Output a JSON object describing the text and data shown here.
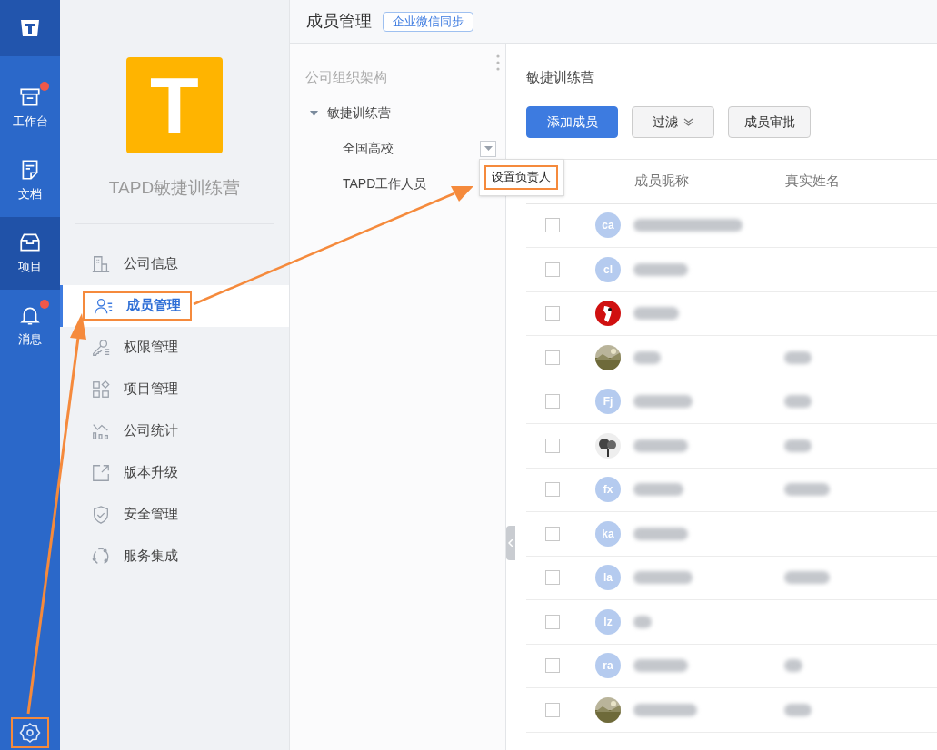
{
  "rail": {
    "items": [
      {
        "kind": "inbox",
        "label": "工作台",
        "selected": false,
        "badge": true
      },
      {
        "kind": "doc",
        "label": "文档",
        "selected": false,
        "badge": false
      },
      {
        "kind": "project",
        "label": "项目",
        "selected": true,
        "badge": false
      },
      {
        "kind": "bell",
        "label": "消息",
        "selected": false,
        "badge": true
      }
    ],
    "settings": {
      "highlighted": true
    }
  },
  "company": {
    "logo_letter": "T",
    "name": "TAPD敏捷训练营"
  },
  "nav": [
    {
      "kind": "building",
      "label": "公司信息",
      "selected": false,
      "highlighted": false
    },
    {
      "kind": "user",
      "label": "成员管理",
      "selected": true,
      "highlighted": true
    },
    {
      "kind": "key",
      "label": "权限管理",
      "selected": false,
      "highlighted": false
    },
    {
      "kind": "grid",
      "label": "项目管理",
      "selected": false,
      "highlighted": false
    },
    {
      "kind": "stats",
      "label": "公司统计",
      "selected": false,
      "highlighted": false
    },
    {
      "kind": "upgrade",
      "label": "版本升级",
      "selected": false,
      "highlighted": false
    },
    {
      "kind": "shield",
      "label": "安全管理",
      "selected": false,
      "highlighted": false
    },
    {
      "kind": "cycle",
      "label": "服务集成",
      "selected": false,
      "highlighted": false
    }
  ],
  "header": {
    "title": "成员管理",
    "sync_button": "企业微信同步"
  },
  "org_tree": {
    "heading": "公司组织架构",
    "root": {
      "label": "敏捷训练营",
      "expanded": true,
      "children": [
        {
          "label": "全国高校",
          "menu_open": true
        },
        {
          "label": "TAPD工作人员",
          "menu_open": false
        }
      ]
    },
    "menu": {
      "items": [
        {
          "label": "设置负责人",
          "highlighted": true
        }
      ]
    }
  },
  "members": {
    "title": "敏捷训练营",
    "buttons": [
      {
        "kind": "primary",
        "label": "添加成员"
      },
      {
        "kind": "dropdown",
        "label": "过滤"
      },
      {
        "kind": "default",
        "label": "成员审批"
      }
    ],
    "columns": [
      "成员昵称",
      "真实姓名"
    ],
    "rows": [
      {
        "kind": "initials",
        "initials": "ca",
        "real_name": false,
        "checked": false
      },
      {
        "kind": "initials",
        "initials": "cl",
        "real_name": false,
        "checked": false
      },
      {
        "kind": "picture",
        "real_name": false,
        "checked": false
      },
      {
        "kind": "picture",
        "real_name": true,
        "checked": false
      },
      {
        "kind": "initials",
        "initials": "Fj",
        "real_name": true,
        "checked": false
      },
      {
        "kind": "picture",
        "real_name": true,
        "checked": false
      },
      {
        "kind": "initials",
        "initials": "fx",
        "real_name": true,
        "checked": false
      },
      {
        "kind": "initials",
        "initials": "ka",
        "real_name": false,
        "checked": false
      },
      {
        "kind": "initials",
        "initials": "la",
        "real_name": true,
        "checked": false
      },
      {
        "kind": "initials",
        "initials": "lz",
        "real_name": false,
        "checked": false
      },
      {
        "kind": "initials",
        "initials": "ra",
        "real_name": true,
        "checked": false
      },
      {
        "kind": "picture",
        "real_name": true,
        "checked": false
      }
    ]
  }
}
